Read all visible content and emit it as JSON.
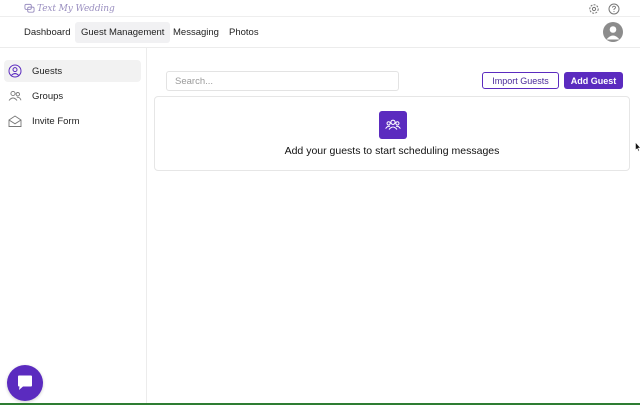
{
  "app": {
    "logo_text": "Text My Wedding"
  },
  "nav": {
    "tabs": [
      {
        "label": "Dashboard",
        "active": false
      },
      {
        "label": "Guest Management",
        "active": true
      },
      {
        "label": "Messaging",
        "active": false
      },
      {
        "label": "Photos",
        "active": false
      }
    ]
  },
  "sidebar": {
    "items": [
      {
        "label": "Guests",
        "icon": "user-circle-icon",
        "active": true
      },
      {
        "label": "Groups",
        "icon": "users-icon",
        "active": false
      },
      {
        "label": "Invite Form",
        "icon": "envelope-open-icon",
        "active": false
      }
    ]
  },
  "main": {
    "search_placeholder": "Search...",
    "import_label": "Import Guests",
    "add_label": "Add Guest",
    "empty_message": "Add your guests to start scheduling messages"
  },
  "colors": {
    "accent": "#5b2bbf",
    "logo": "#9a8fc0"
  }
}
